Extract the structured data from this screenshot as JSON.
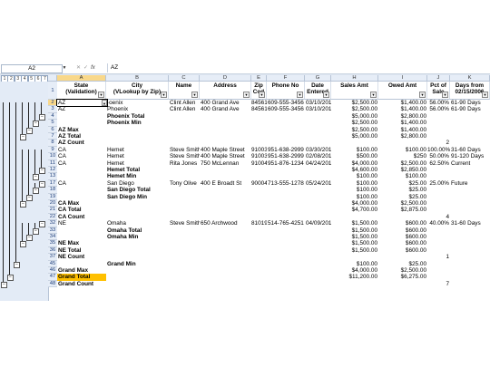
{
  "formula_bar": {
    "name_box": "A2",
    "fx_label": "fx",
    "formula_value": "AZ"
  },
  "outline_levels": [
    "1",
    "2",
    "3",
    "4",
    "5",
    "6",
    "7"
  ],
  "columns": [
    "A",
    "B",
    "C",
    "D",
    "E",
    "F",
    "G",
    "H",
    "I",
    "J",
    "K"
  ],
  "headers": {
    "row_number": "1",
    "A": [
      "State",
      "(Validation)"
    ],
    "B": [
      "City",
      "(VLookup by Zip)"
    ],
    "C": [
      "Name",
      ""
    ],
    "D": [
      "Address",
      ""
    ],
    "E": [
      "Zip",
      "Cod"
    ],
    "F": [
      "Phone No",
      ""
    ],
    "G": [
      "Date",
      "Entered"
    ],
    "H": [
      "Sales Amt",
      ""
    ],
    "I": [
      "Owed Amt",
      ""
    ],
    "J": [
      "Pct of",
      "Sale"
    ],
    "K": [
      "Days from",
      "02/15/2006"
    ]
  },
  "rows": [
    {
      "n": "2",
      "A": "AZ",
      "B": "·oenix",
      "C": "Clint Allen",
      "D": "400 Grand Ave",
      "E": "84561",
      "F": "609-555-3456",
      "G": "03/10/2014",
      "H": "$2,500.00",
      "I": "$1,400.00",
      "J": "56.00%",
      "K": "61-90 Days"
    },
    {
      "n": "3",
      "A": "AZ",
      "B": "Phoenix",
      "C": "Clint Allen",
      "D": "400 Grand Ave",
      "E": "84561",
      "F": "609-555-3456",
      "G": "03/10/2014",
      "H": "$2,500.00",
      "I": "$1,400.00",
      "J": "56.00%",
      "K": "61-90 Days"
    },
    {
      "n": "4",
      "A": "",
      "B": "Phoenix Total",
      "H": "$5,000.00",
      "I": "$2,800.00",
      "bold": true
    },
    {
      "n": "5",
      "A": "",
      "B": "Phoenix Min",
      "H": "$2,500.00",
      "I": "$1,400.00",
      "bold": true
    },
    {
      "n": "6",
      "A": "AZ Max",
      "H": "$2,500.00",
      "I": "$1,400.00",
      "bold": true
    },
    {
      "n": "7",
      "A": "AZ Total",
      "H": "$5,000.00",
      "I": "$2,800.00",
      "bold": true
    },
    {
      "n": "8",
      "A": "AZ Count",
      "J": "2",
      "bold": true
    },
    {
      "n": "9",
      "A": "CA",
      "B": "Hemet",
      "C": "Steve Smith",
      "D": "400 Maple Street",
      "E": "91003",
      "F": "951-638-2999",
      "G": "03/30/2014",
      "H": "$100.00",
      "I": "$100.00",
      "J": "100.00%",
      "K": "31-60 Days"
    },
    {
      "n": "10",
      "A": "CA",
      "B": "Hemet",
      "C": "Steve Smith",
      "D": "400 Maple Street",
      "E": "91003",
      "F": "951-638-2999",
      "G": "02/08/2014",
      "H": "$500.00",
      "I": "$250",
      "J": "50.00%",
      "K": "91-120 Days"
    },
    {
      "n": "11",
      "A": "CA",
      "B": "Hemet",
      "C": "Rita Jones",
      "D": "750 McLennan",
      "E": "91004",
      "F": "951-876-1234",
      "G": "04/24/2014",
      "H": "$4,000.00",
      "I": "$2,500.00",
      "J": "62.50%",
      "K": "Current"
    },
    {
      "n": "12",
      "A": "",
      "B": "Hemet Total",
      "H": "$4,600.00",
      "I": "$2,850.00",
      "bold": true
    },
    {
      "n": "13",
      "A": "",
      "B": "Hemet Min",
      "H": "$100.00",
      "I": "$100.00",
      "bold": true
    },
    {
      "n": "17",
      "A": "CA",
      "B": "San Diego",
      "C": "Tony Olive",
      "D": "400 E Broadt St",
      "E": "90004",
      "F": "713-555-1278",
      "G": "05/24/2014",
      "H": "$100.00",
      "I": "$25.00",
      "J": "25.00%",
      "K": "Future"
    },
    {
      "n": "18",
      "A": "",
      "B": "San Diego Total",
      "H": "$100.00",
      "I": "$25.00",
      "bold": true
    },
    {
      "n": "19",
      "A": "",
      "B": "San Diego Min",
      "H": "$100.00",
      "I": "$25.00",
      "bold": true
    },
    {
      "n": "20",
      "A": "CA Max",
      "H": "$4,000.00",
      "I": "$2,500.00",
      "bold": true
    },
    {
      "n": "21",
      "A": "CA Total",
      "H": "$4,700.00",
      "I": "$2,875.00",
      "bold": true
    },
    {
      "n": "22",
      "A": "CA Count",
      "J": "4",
      "bold": true
    },
    {
      "n": "32",
      "A": "NE",
      "B": "Omaha",
      "C": "Steve Smith",
      "D": "650 Archwood",
      "E": "81019",
      "F": "514-765-4251",
      "G": "04/09/2014",
      "H": "$1,500.00",
      "I": "$600.00",
      "J": "40.00%",
      "K": "31-60 Days"
    },
    {
      "n": "33",
      "A": "",
      "B": "Omaha Total",
      "H": "$1,500.00",
      "I": "$600.00",
      "bold": true
    },
    {
      "n": "34",
      "A": "",
      "B": "Omaha Min",
      "H": "$1,500.00",
      "I": "$600.00",
      "bold": true
    },
    {
      "n": "35",
      "A": "NE Max",
      "H": "$1,500.00",
      "I": "$600.00",
      "bold": true
    },
    {
      "n": "36",
      "A": "NE Total",
      "H": "$1,500.00",
      "I": "$600.00",
      "bold": true
    },
    {
      "n": "37",
      "A": "NE Count",
      "J": "1",
      "bold": true
    },
    {
      "n": "45",
      "A": "",
      "B": "Grand Min",
      "H": "$100.00",
      "I": "$25.00",
      "bold": true
    },
    {
      "n": "46",
      "A": "Grand Max",
      "H": "$4,000.00",
      "I": "$2,500.00",
      "bold": true
    },
    {
      "n": "47",
      "A": "Grand Total",
      "H": "$11,200.00",
      "I": "$6,275.00",
      "bold": true,
      "highlight": true
    },
    {
      "n": "48",
      "A": "Grand Count",
      "J": "7",
      "bold": true
    }
  ]
}
